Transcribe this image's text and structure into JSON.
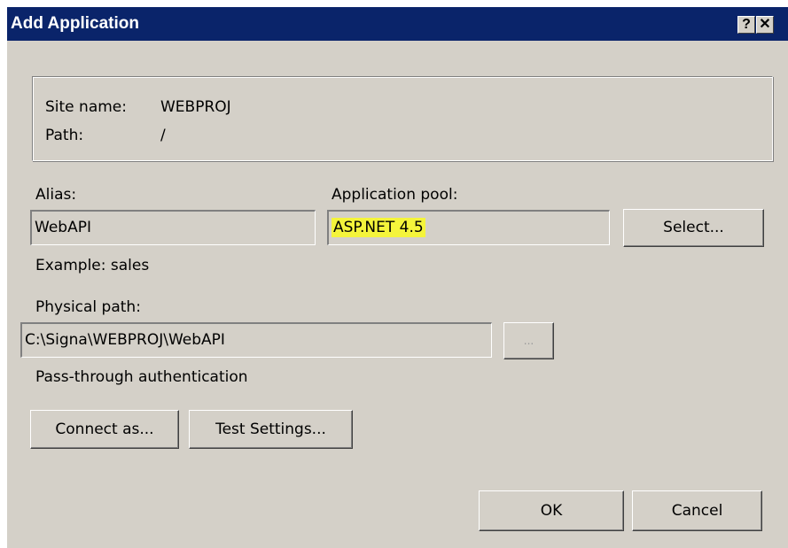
{
  "window": {
    "title": "Add Application",
    "help_glyph": "?",
    "close_glyph": "✕"
  },
  "site_info": {
    "site_name_label": "Site name:",
    "site_name_value": "WEBPROJ",
    "path_label": "Path:",
    "path_value": "/"
  },
  "alias": {
    "label": "Alias:",
    "value": "WebAPI",
    "example": "Example: sales"
  },
  "app_pool": {
    "label": "Application pool:",
    "value": "ASP.NET 4.5",
    "select_button": "Select..."
  },
  "physical_path": {
    "label": "Physical path:",
    "value": "C:\\Signa\\WEBPROJ\\WebAPI",
    "browse_button": "...",
    "auth_text": "Pass-through authentication"
  },
  "buttons": {
    "connect_as": "Connect as...",
    "test_settings": "Test Settings...",
    "ok": "OK",
    "cancel": "Cancel"
  },
  "colors": {
    "titlebar": "#0a246a",
    "dialog_face": "#d4d0c8",
    "highlight": "#f4f43b"
  }
}
